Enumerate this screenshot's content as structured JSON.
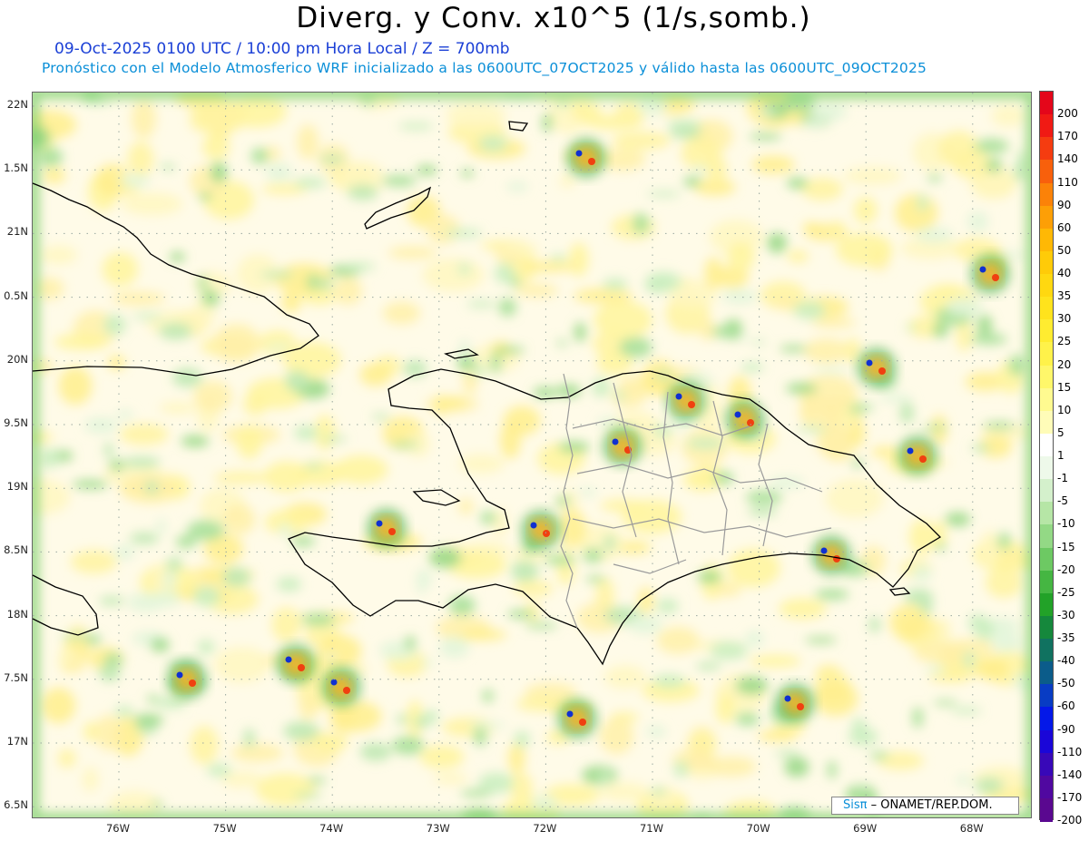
{
  "header": {
    "title": "Diverg. y Conv. x10^5 (1/s,somb.)",
    "subtitle": "09-Oct-2025  0100 UTC / 10:00 pm Hora Local / Z = 700mb",
    "description": "Pronóstico con el Modelo Atmosferico WRF inicializado a las 0600UTC_07OCT2025 y válido hasta las  0600UTC_09OCT2025"
  },
  "axes": {
    "y_ticks": [
      "22N",
      "1.5N",
      "21N",
      "0.5N",
      "20N",
      "9.5N",
      "19N",
      "8.5N",
      "18N",
      "7.5N",
      "17N",
      "6.5N"
    ],
    "x_ticks": [
      "76W",
      "75W",
      "74W",
      "73W",
      "72W",
      "71W",
      "70W",
      "69W",
      "68W"
    ]
  },
  "colorbar": {
    "labels": [
      "200",
      "170",
      "140",
      "110",
      "90",
      "60",
      "50",
      "40",
      "35",
      "30",
      "25",
      "20",
      "15",
      "10",
      "5",
      "1",
      "-1",
      "-5",
      "-10",
      "-15",
      "-20",
      "-25",
      "-30",
      "-35",
      "-40",
      "-50",
      "-60",
      "-90",
      "-110",
      "-140",
      "-170",
      "-200"
    ],
    "colors": [
      "#e4061a",
      "#f01a14",
      "#f53c10",
      "#f8600c",
      "#fb8208",
      "#fd9f06",
      "#ffb805",
      "#ffcb08",
      "#ffd810",
      "#ffe31c",
      "#ffec30",
      "#fff24a",
      "#fff76a",
      "#fffa90",
      "#fffcb8",
      "#ffffff",
      "#eef9ea",
      "#d4f0cc",
      "#b6e6a6",
      "#93d985",
      "#6dc963",
      "#45b642",
      "#22a228",
      "#15883c",
      "#107260",
      "#0b5c8a",
      "#083cc4",
      "#0418e8",
      "#1a06d8",
      "#3808b8",
      "#5008a0",
      "#5a0890"
    ]
  },
  "credit": {
    "brand": "Sisπ",
    "org": " – ONAMET/REP.DOM."
  }
}
